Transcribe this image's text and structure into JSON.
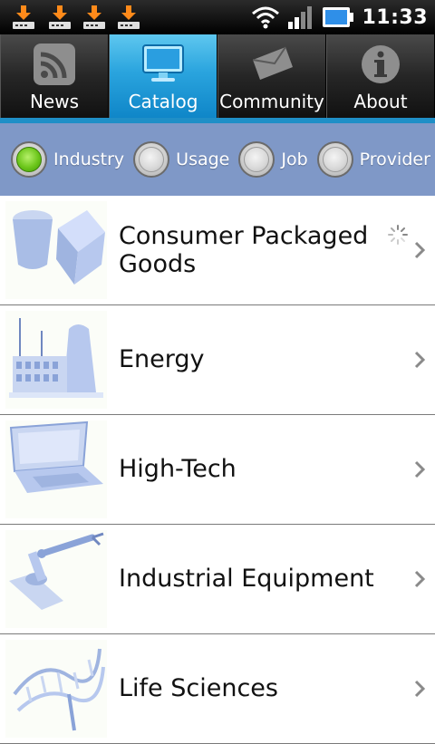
{
  "status_bar": {
    "time": "11:33",
    "notification_icons": [
      "download-icon",
      "download-icon",
      "download-icon",
      "download-icon"
    ],
    "indicators": [
      "wifi-icon",
      "signal-icon",
      "battery-icon"
    ]
  },
  "tabs": [
    {
      "label": "News",
      "icon": "rss-icon",
      "active": false
    },
    {
      "label": "Catalog",
      "icon": "monitor-icon",
      "active": true
    },
    {
      "label": "Community",
      "icon": "envelope-icon",
      "active": false
    },
    {
      "label": "About",
      "icon": "info-icon",
      "active": false
    }
  ],
  "filters": [
    {
      "label": "Industry",
      "checked": true
    },
    {
      "label": "Usage",
      "checked": false
    },
    {
      "label": "Job",
      "checked": false
    },
    {
      "label": "Provider",
      "checked": false
    }
  ],
  "list": [
    {
      "label": "Consumer Packaged Goods",
      "icon": "packaged-goods-icon",
      "loading": true
    },
    {
      "label": "Energy",
      "icon": "energy-plant-icon",
      "loading": false
    },
    {
      "label": "High-Tech",
      "icon": "laptop-icon",
      "loading": false
    },
    {
      "label": "Industrial Equipment",
      "icon": "robot-arm-icon",
      "loading": false
    },
    {
      "label": "Life Sciences",
      "icon": "dna-icon",
      "loading": false
    }
  ],
  "colors": {
    "active_tab": "#2aa4de",
    "filter_bar": "#7f98c7",
    "radio_checked": "#6cc61b"
  }
}
